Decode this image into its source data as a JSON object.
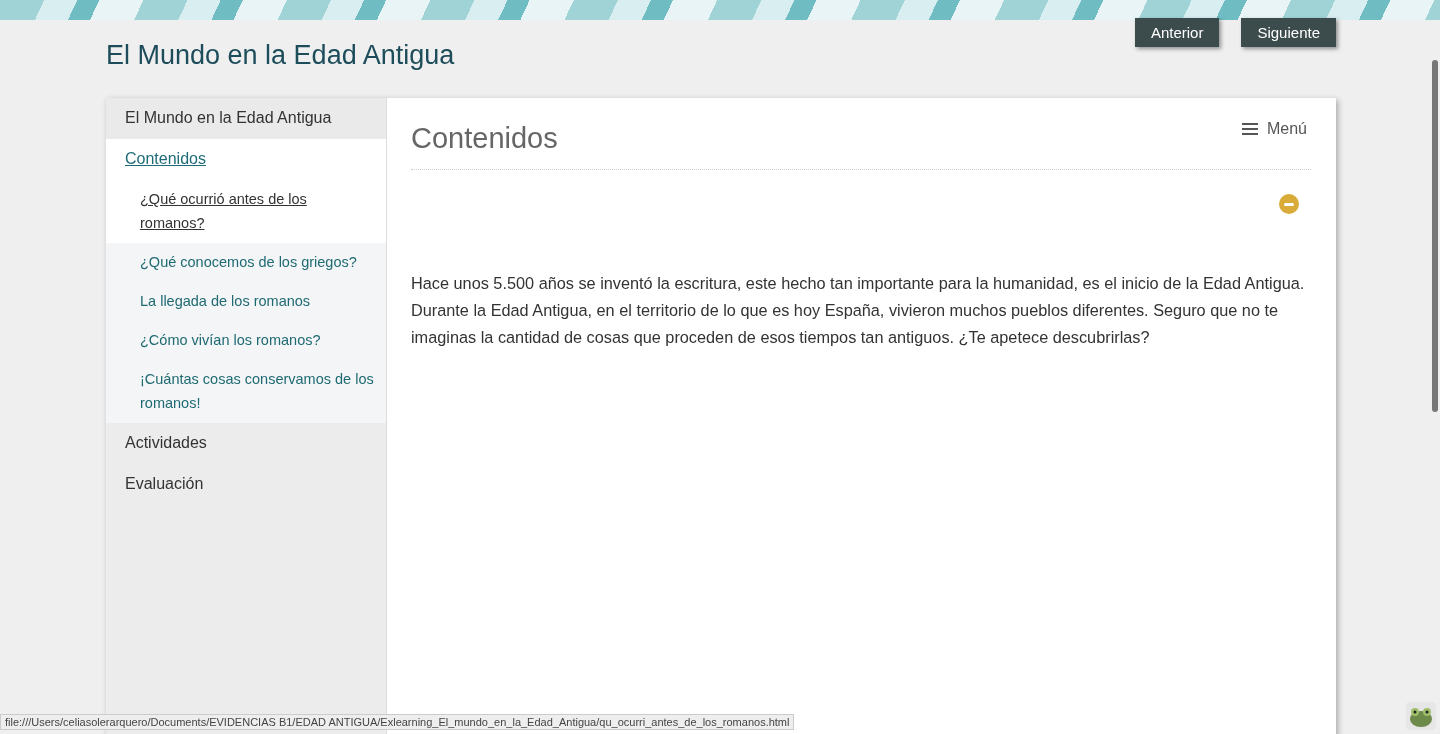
{
  "site_title": "El Mundo en la Edad Antigua",
  "nav_buttons": [
    {
      "label": "Anterior"
    },
    {
      "label": "Siguiente"
    }
  ],
  "sidebar": {
    "items": [
      {
        "label": "El Mundo en la Edad Antigua",
        "selected": false
      },
      {
        "label": "Contenidos",
        "selected": true,
        "children": [
          {
            "label": "¿Qué ocurrió antes de los romanos?",
            "hovered": true
          },
          {
            "label": "¿Qué conocemos de los griegos?",
            "hovered": false
          },
          {
            "label": "La llegada de los romanos",
            "hovered": false
          },
          {
            "label": "¿Cómo vivían los romanos?",
            "hovered": false
          },
          {
            "label": "¡Cuántas cosas conservamos de los romanos!",
            "hovered": false
          }
        ]
      },
      {
        "label": "Actividades",
        "selected": false
      },
      {
        "label": "Evaluación",
        "selected": false
      }
    ]
  },
  "content": {
    "heading": "Contenidos",
    "menu_label": "Menú",
    "block_expanded": true,
    "paragraph": "Hace unos 5.500 años se inventó la escritura, este hecho tan importante para la humanidad, es el inicio de la Edad Antigua. Durante la Edad Antigua, en el territorio de lo que es hoy España, vivieron muchos pueblos diferentes. Seguro que no te imaginas la cantidad de cosas que proceden de esos tiempos tan antiguos. ¿Te apetece descubrirlas?"
  },
  "status_bar": "file:///Users/celiasolerarquero/Documents/EVIDENCIAS B1/EDAD ANTIGUA/Exlearning_El_mundo_en_la_Edad_Antigua/qu_ocurri_antes_de_los_romanos.html"
}
